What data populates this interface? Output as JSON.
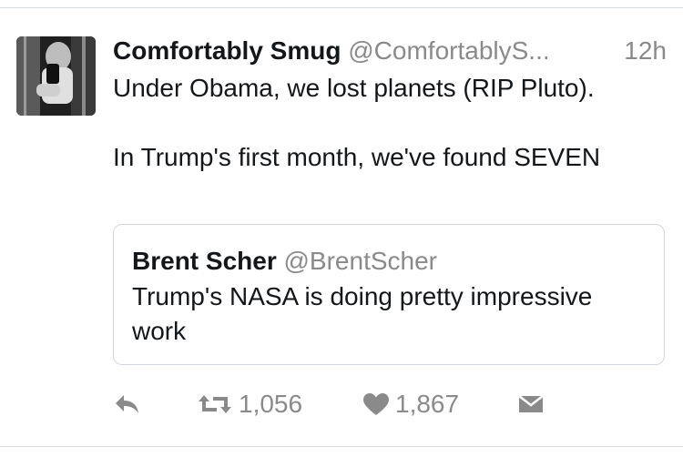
{
  "tweet": {
    "author_name": "Comfortably Smug",
    "author_handle": "@ComfortablyS...",
    "time": "12h",
    "lines": [
      "Under Obama, we lost planets (RIP Pluto).",
      "In Trump's first month, we've found SEVEN"
    ]
  },
  "quoted": {
    "author_name": "Brent Scher",
    "author_handle": "@BrentScher",
    "text_lines": [
      "Trump's NASA is doing pretty impressive",
      "work"
    ]
  },
  "actions": {
    "retweets": "1,056",
    "likes": "1,867"
  },
  "icons": [
    "reply-icon",
    "retweet-icon",
    "like-icon",
    "direct-message-icon"
  ],
  "colors": {
    "muted": "#8a8a8a",
    "text": "#14171a",
    "border": "#d0d6db"
  }
}
